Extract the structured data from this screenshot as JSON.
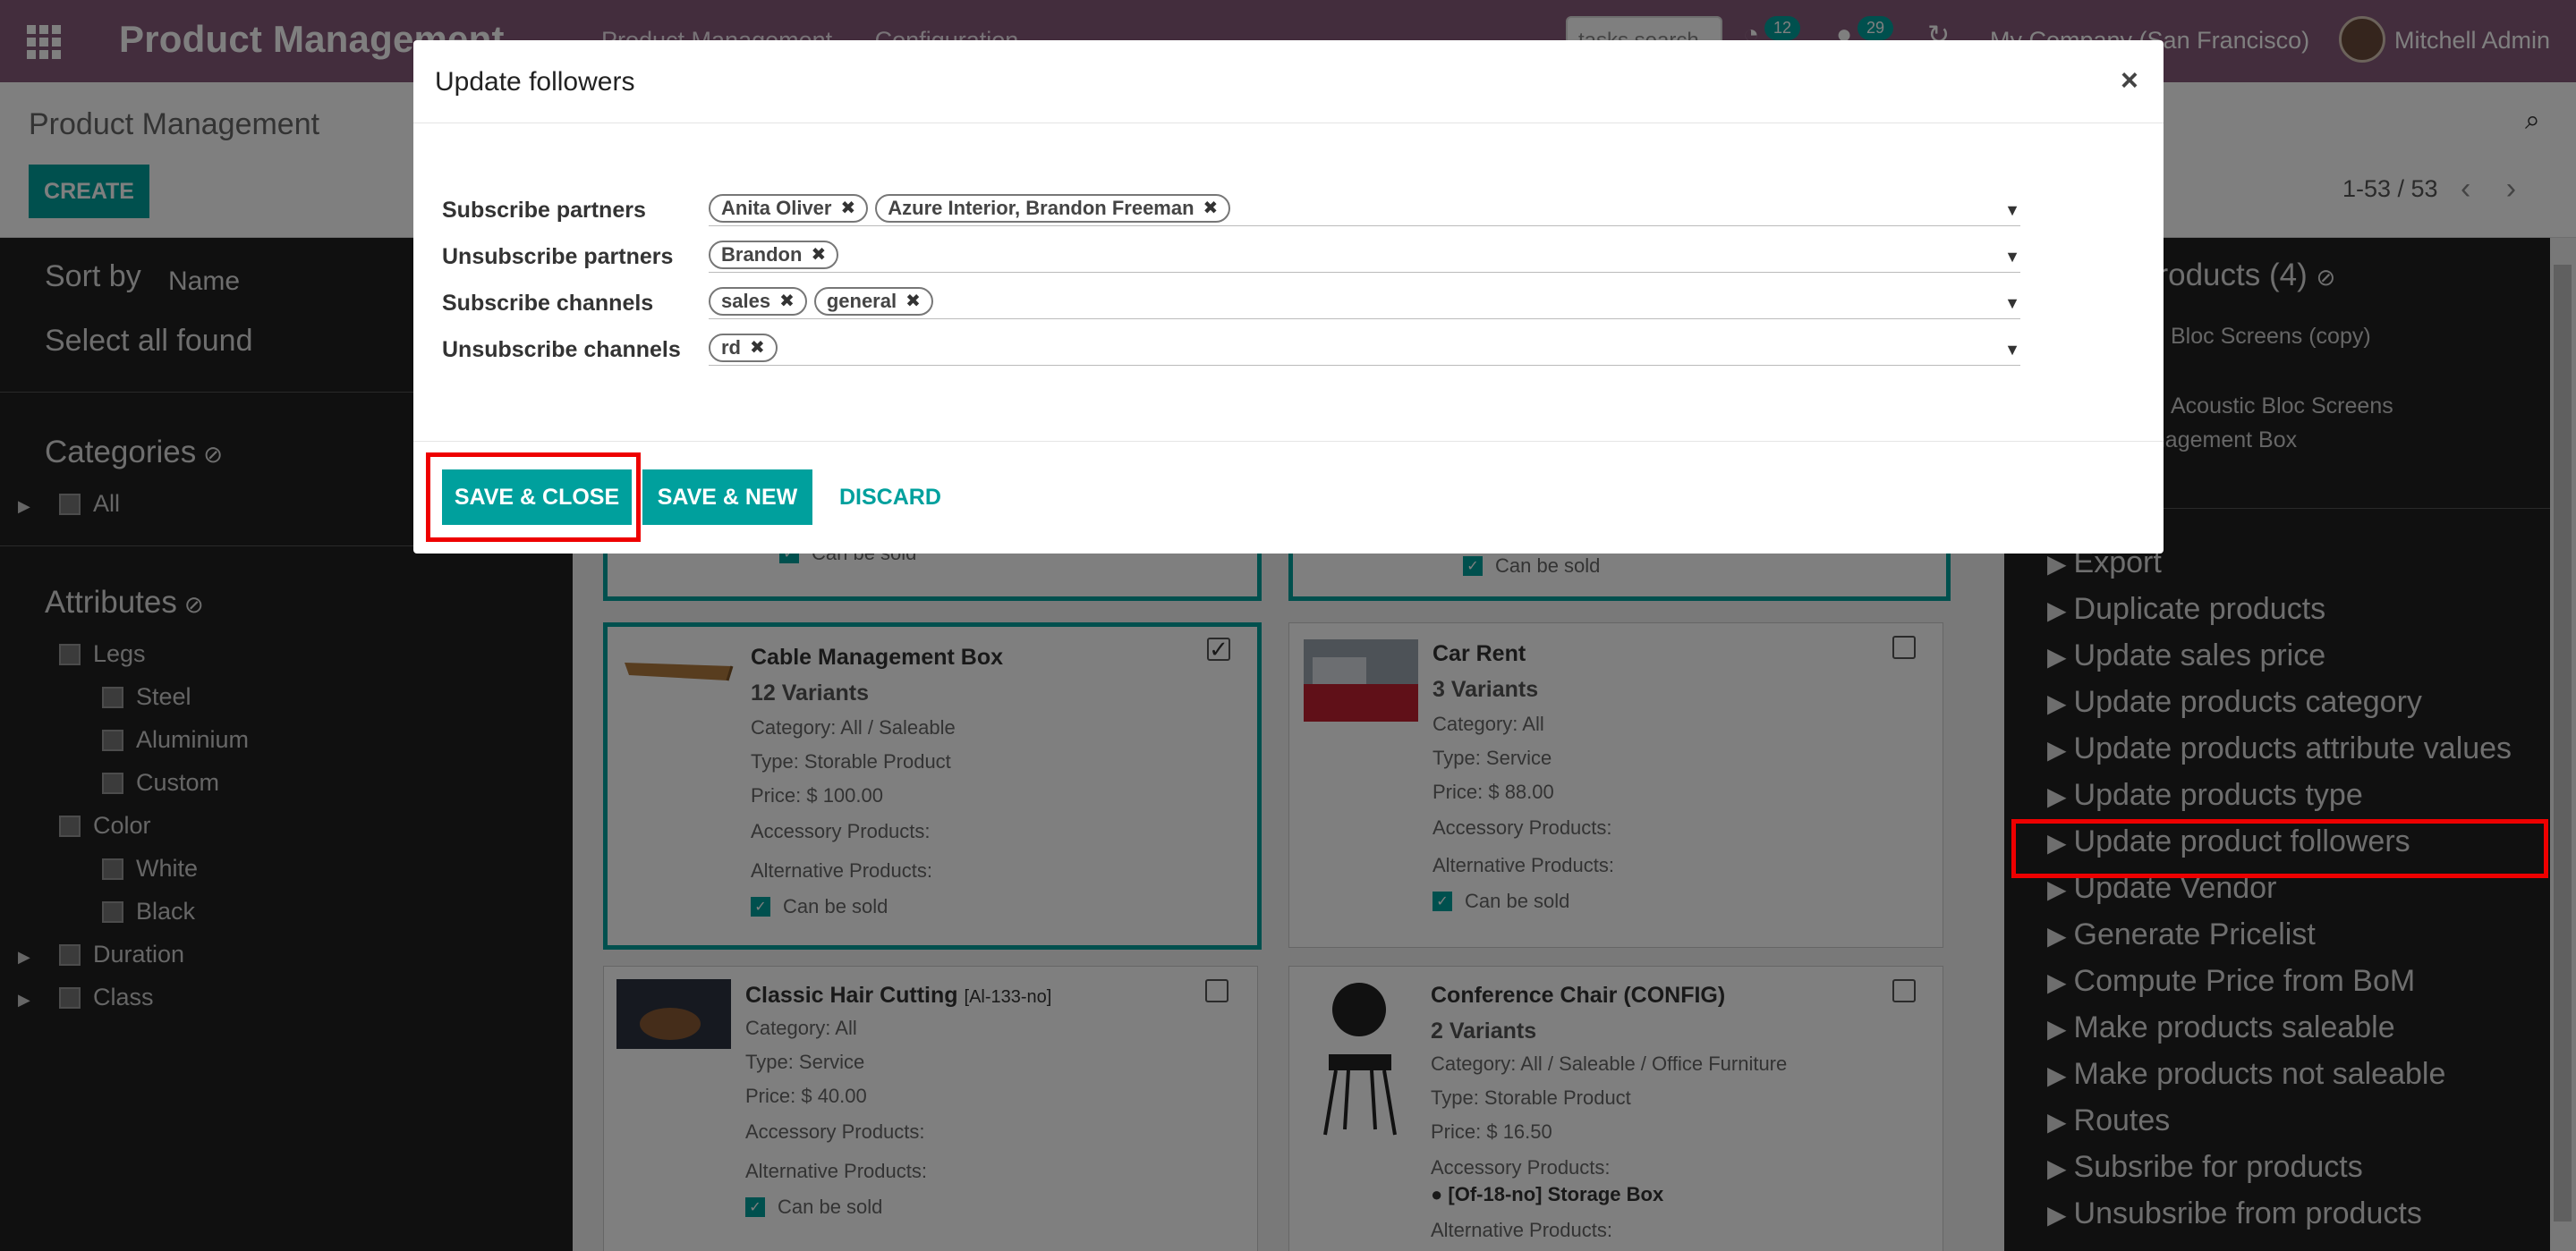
{
  "topbar": {
    "brand": "Product Management",
    "menu": [
      "Product Management",
      "Configuration"
    ],
    "search_placeholder": "tasks search",
    "activity_count": "12",
    "message_count": "29",
    "company": "My Company (San Francisco)",
    "user": "Mitchell Admin"
  },
  "control_panel": {
    "title": "Product Management",
    "create_label": "CREATE",
    "pager": "1-53 / 53"
  },
  "sidebar": {
    "sort_by": "Sort by",
    "sort_value": "Name",
    "select_all": "Select all found",
    "categories_title": "Categories",
    "categories": [
      "All"
    ],
    "attributes_title": "Attributes",
    "attributes": [
      {
        "name": "Legs",
        "children": [
          "Steel",
          "Aluminium",
          "Custom"
        ]
      },
      {
        "name": "Color",
        "children": [
          "White",
          "Black"
        ]
      },
      {
        "name": "Duration",
        "children": []
      },
      {
        "name": "Class",
        "children": []
      }
    ]
  },
  "cards": [
    {
      "name": "Cable Management Box",
      "variants": "12 Variants",
      "category": "Category: All / Saleable",
      "type": "Type: Storable Product",
      "price": "Price: $ 100.00",
      "accessory": "Accessory Products:",
      "alternative": "Alternative Products:",
      "sold": "Can be sold"
    },
    {
      "name": "Car Rent",
      "variants": "3 Variants",
      "category": "Category: All",
      "type": "Type: Service",
      "price": "Price: $ 88.00",
      "accessory": "Accessory Products:",
      "alternative": "Alternative Products:",
      "sold": "Can be sold"
    },
    {
      "name": "Classic Hair Cutting",
      "code": "[Al-133-no]",
      "category": "Category: All",
      "type": "Type: Service",
      "price": "Price: $ 40.00",
      "accessory": "Accessory Products:",
      "alternative": "Alternative Products:",
      "sold": "Can be sold"
    },
    {
      "name": "Conference Chair (CONFIG)",
      "variants": "2 Variants",
      "category": "Category: All / Saleable / Office Furniture",
      "type": "Type: Storable Product",
      "price": "Price: $ 16.50",
      "accessory": "Accessory Products:",
      "accessory_item": "[Of-18-no] Storage Box",
      "alternative": "Alternative Products:"
    }
  ],
  "top_cards_sold": [
    "Can be sold",
    "Can be sold"
  ],
  "actions": {
    "header": "products (4)",
    "selected_lines": [
      "Bloc Screens (copy)",
      "Acoustic Bloc Screens",
      "anagement Box"
    ],
    "items": [
      "Export",
      "Duplicate products",
      "Update sales price",
      "Update products category",
      "Update products attribute values",
      "Update products type",
      "Update product followers",
      "Update Vendor",
      "Generate Pricelist",
      "Compute Price from BoM",
      "Make products saleable",
      "Make products not saleable",
      "Routes",
      "Subsribe for products",
      "Unsubsribe from products"
    ]
  },
  "modal": {
    "title": "Update followers",
    "fields": [
      {
        "label": "Subscribe partners",
        "tags": [
          "Anita Oliver",
          "Azure Interior, Brandon Freeman"
        ]
      },
      {
        "label": "Unsubscribe partners",
        "tags": [
          "Brandon"
        ]
      },
      {
        "label": "Subscribe channels",
        "tags": [
          "sales",
          "general"
        ]
      },
      {
        "label": "Unsubscribe channels",
        "tags": [
          "rd"
        ]
      }
    ],
    "save_close": "SAVE & CLOSE",
    "save_new": "SAVE & NEW",
    "discard": "DISCARD"
  },
  "colors": {
    "brand": "#875a7b",
    "accent": "#00a09d",
    "highlight": "#ee0000"
  }
}
